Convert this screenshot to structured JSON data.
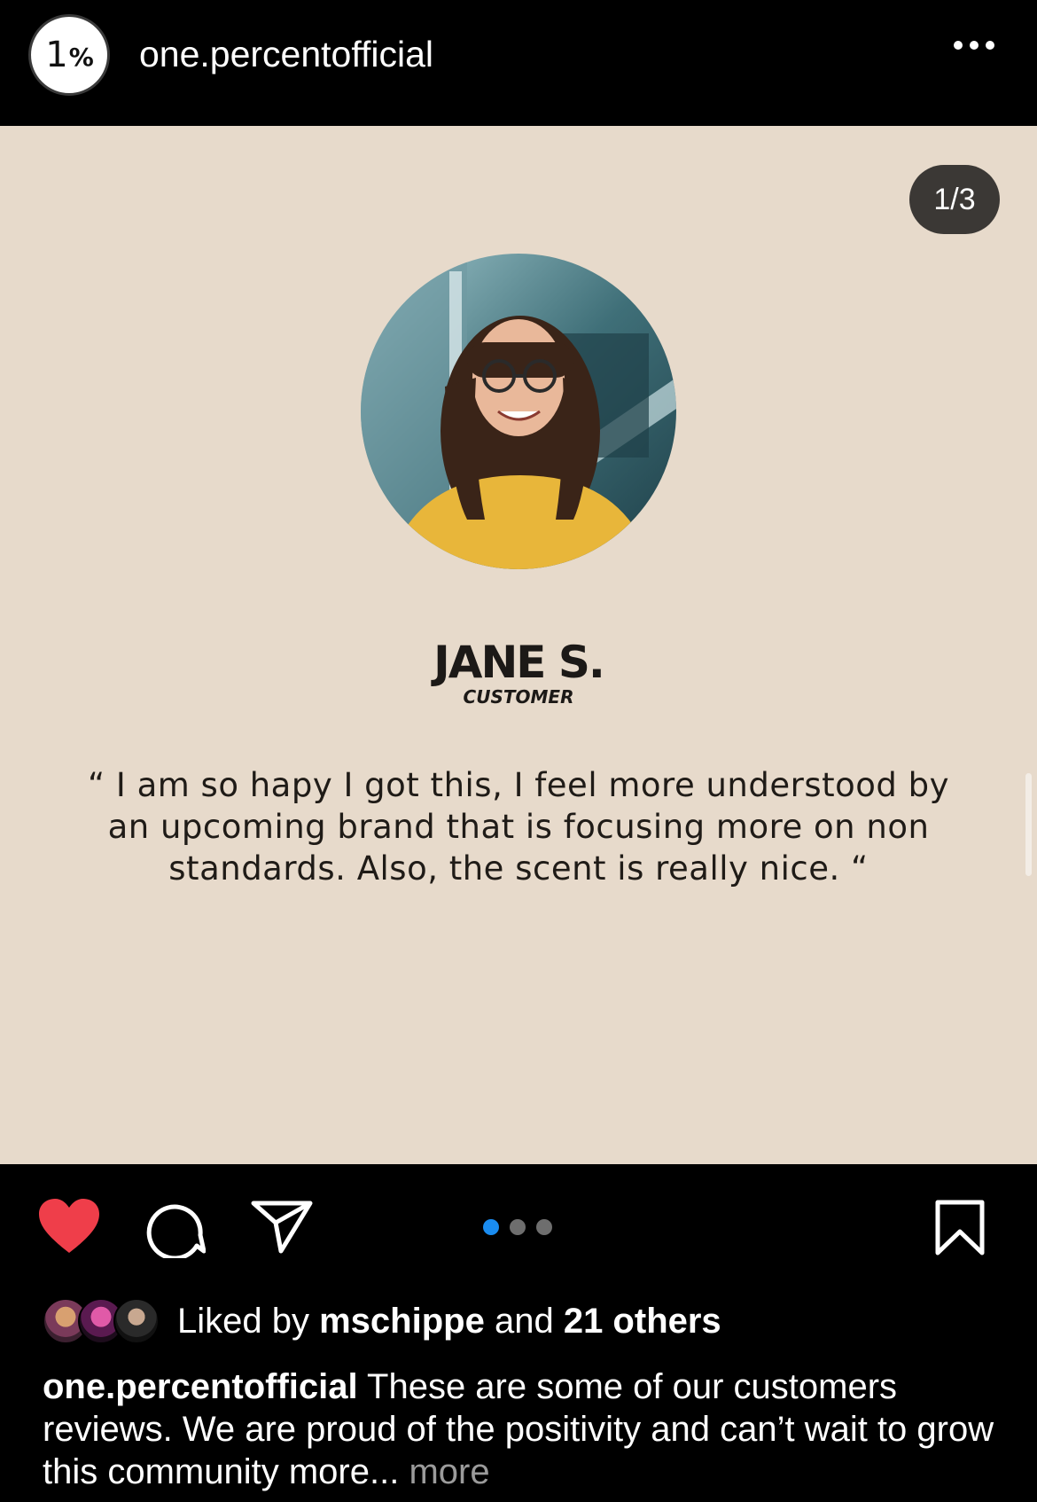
{
  "header": {
    "avatar_text": "1",
    "avatar_pct": "%",
    "username": "one.percentofficial"
  },
  "post": {
    "counter": "1/3",
    "name": "JANE S.",
    "role": "CUSTOMER",
    "quote": "“ I am so hapy I got this, I feel more understood by an upcoming brand that is focusing more on non standards. Also, the scent is really nice. “",
    "background_color": "#e7dacb"
  },
  "actions": {
    "icons": [
      "heart-icon",
      "comment-icon",
      "share-icon",
      "bookmark-icon"
    ],
    "liked": true,
    "like_color": "#ef3e4a",
    "carousel_active_index": 0,
    "carousel_count": 3,
    "carousel_active_color": "#1a8cf0"
  },
  "likes": {
    "prefix": "Liked by",
    "user": "mschippe",
    "middle": "and",
    "others": "21 others"
  },
  "caption": {
    "username": "one.percentofficial",
    "text": "These are some of our customers reviews. We are proud of the positivity and can’t wait to grow this community more...",
    "more": "more"
  }
}
